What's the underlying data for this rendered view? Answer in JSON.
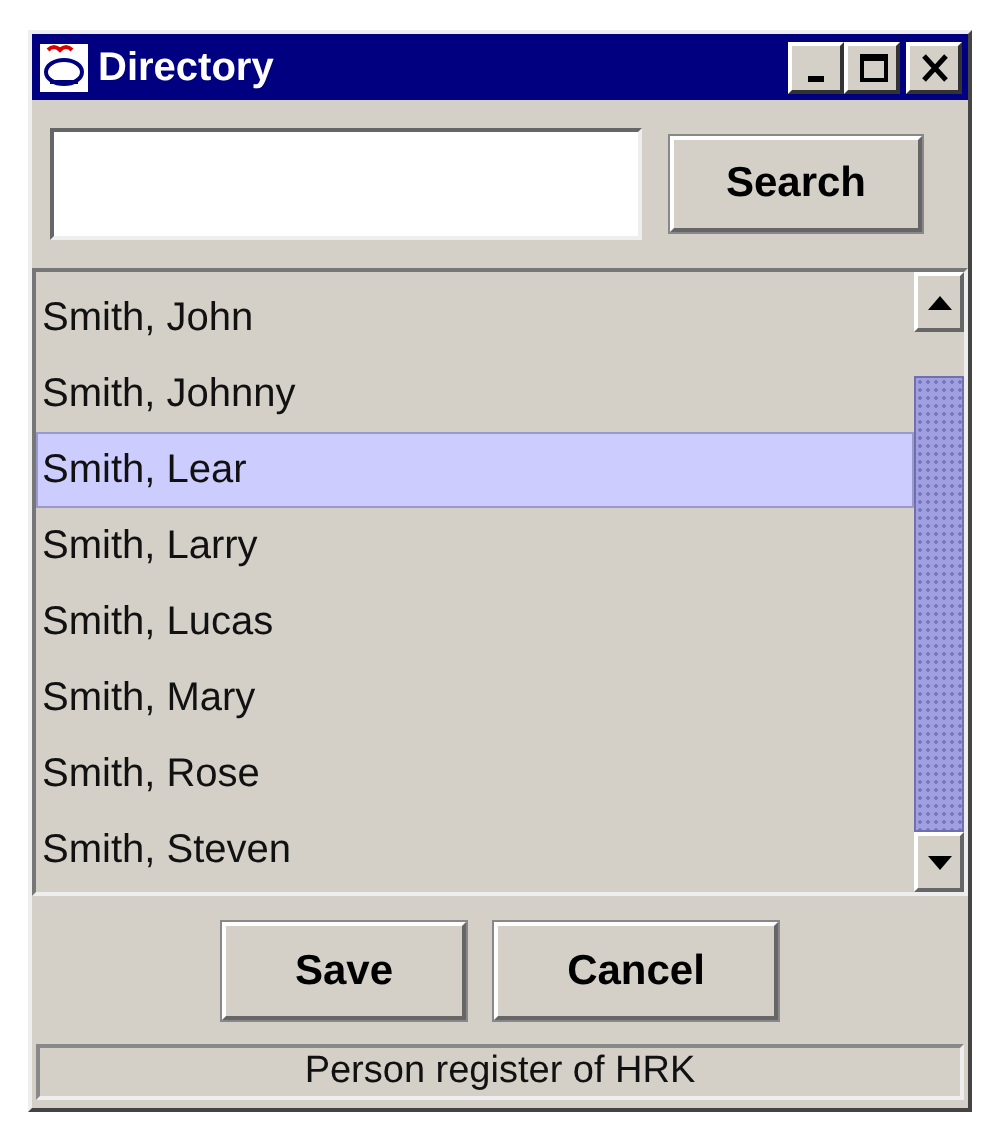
{
  "window": {
    "title": "Directory"
  },
  "search": {
    "button": "Search"
  },
  "list": {
    "items": [
      {
        "label": "Smith, John",
        "selected": false
      },
      {
        "label": "Smith, Johnny",
        "selected": false
      },
      {
        "label": "Smith, Lear",
        "selected": true
      },
      {
        "label": "Smith, Larry",
        "selected": false
      },
      {
        "label": "Smith, Lucas",
        "selected": false
      },
      {
        "label": "Smith, Mary",
        "selected": false
      },
      {
        "label": "Smith, Rose",
        "selected": false
      },
      {
        "label": "Smith, Steven",
        "selected": false
      }
    ]
  },
  "buttons": [
    "Save",
    "Cancel"
  ],
  "status_bar": "Person register of HRK"
}
